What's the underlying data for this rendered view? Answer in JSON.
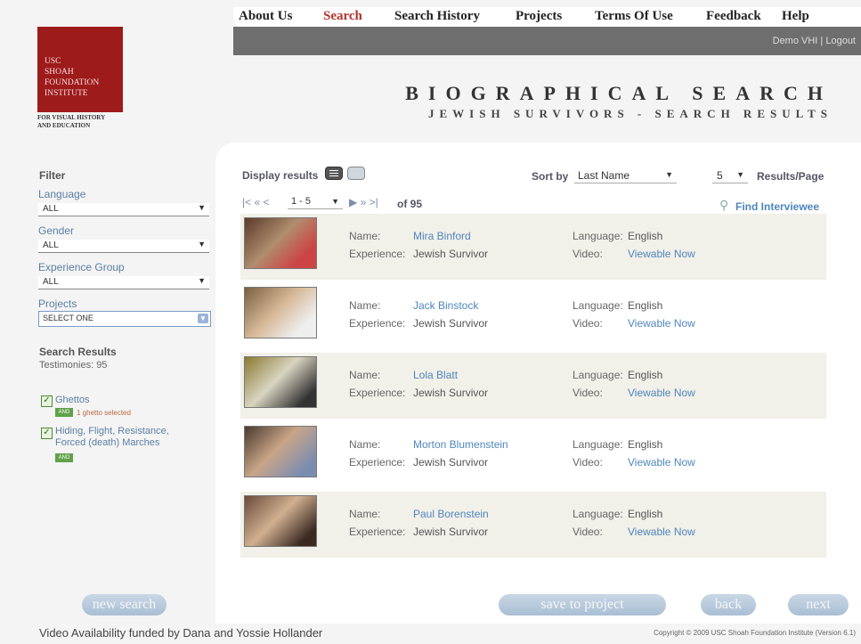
{
  "nav": [
    "About Us",
    "Search",
    "Search History",
    "Projects",
    "Terms Of Use",
    "Feedback",
    "Help"
  ],
  "nav_active": "Search",
  "user": {
    "name": "Demo VHI",
    "sep": "|",
    "logout": "Logout"
  },
  "logo": {
    "lines": [
      "USC",
      "SHOAH",
      "FOUNDATION",
      "INSTITUTE"
    ],
    "sub": [
      "FOR VISUAL HISTORY",
      "AND EDUCATION"
    ]
  },
  "title": "BIOGRAPHICAL SEARCH",
  "subtitle": "JEWISH SURVIVORS - SEARCH RESULTS",
  "filter": {
    "heading": "Filter",
    "language_label": "Language",
    "language_value": "ALL",
    "gender_label": "Gender",
    "gender_value": "ALL",
    "experience_label": "Experience Group",
    "experience_value": "ALL",
    "projects_label": "Projects",
    "projects_value": "SELECT ONE"
  },
  "search_results": {
    "heading": "Search Results",
    "testimonies": "Testimonies: 95",
    "items": [
      {
        "label": "Ghettos",
        "and": "AND",
        "note": "1 ghetto selected"
      },
      {
        "label": "Hiding, Flight, Resistance, Forced (death) Marches",
        "and": "AND",
        "note": ""
      }
    ]
  },
  "toolbar": {
    "display_results": "Display results",
    "sort_by": "Sort by",
    "sort_value": "Last Name",
    "per_page": "5",
    "results_page": "Results/Page",
    "range": "1 - 5",
    "of_total": "of 95",
    "find": "Find Interviewee"
  },
  "labels": {
    "name": "Name:",
    "experience": "Experience:",
    "language": "Language:",
    "video": "Video:"
  },
  "results": [
    {
      "name": "Mira Binford",
      "experience": "Jewish Survivor",
      "language": "English",
      "video": "Viewable Now"
    },
    {
      "name": "Jack Binstock",
      "experience": "Jewish Survivor",
      "language": "English",
      "video": "Viewable Now"
    },
    {
      "name": "Lola Blatt",
      "experience": "Jewish Survivor",
      "language": "English",
      "video": "Viewable Now"
    },
    {
      "name": "Morton Blumenstein",
      "experience": "Jewish Survivor",
      "language": "English",
      "video": "Viewable Now"
    },
    {
      "name": "Paul Borenstein",
      "experience": "Jewish Survivor",
      "language": "English",
      "video": "Viewable Now"
    }
  ],
  "buttons": {
    "new_search": "new search",
    "save_to_project": "save to project",
    "back": "back",
    "next": "next"
  },
  "footer": {
    "left": "Video Availability funded by Dana and Yossie Hollander",
    "right": "Copyright © 2009 USC Shoah Foundation Institute (Version 6.1)"
  },
  "colors": {
    "accent": "#b3322c",
    "link": "#4f86bd",
    "logo": "#9e1b1b"
  }
}
